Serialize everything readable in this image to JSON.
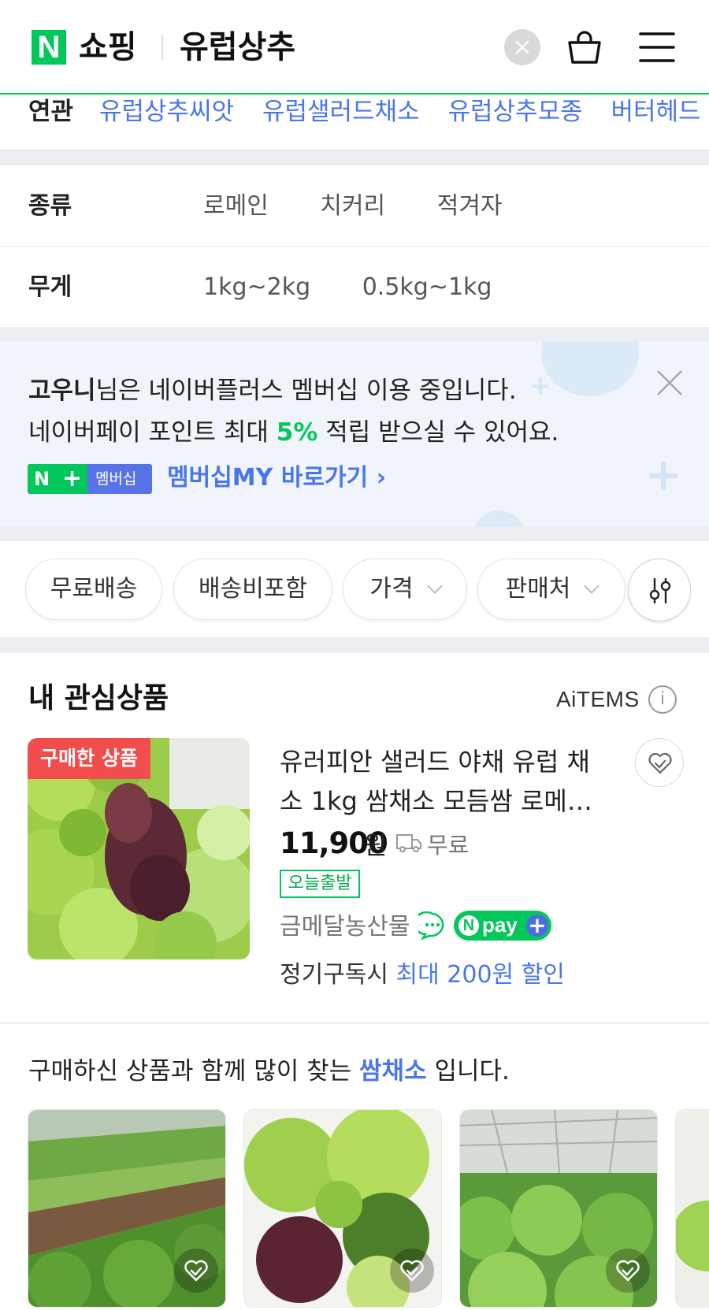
{
  "header": {
    "logo_letter": "N",
    "logo_text": "쇼핑",
    "query": "유럽상추"
  },
  "related": {
    "label": "연관",
    "items": [
      "유럽상추씨앗",
      "유럽샐러드채소",
      "유럽상추모종",
      "버터헤드"
    ]
  },
  "filters": [
    {
      "label": "종류",
      "options": [
        "로메인",
        "치커리",
        "적겨자"
      ]
    },
    {
      "label": "무게",
      "options": [
        "1kg~2kg",
        "0.5kg~1kg"
      ]
    }
  ],
  "banner": {
    "name": "고우니",
    "line1_rest": "님은 네이버플러스 멤버십 이용 중입니다.",
    "line2_pre": "네이버페이 포인트 최대 ",
    "line2_pct": "5%",
    "line2_post": " 적립 받으실 수 있어요.",
    "badge_n": "N",
    "badge_plus": "+",
    "badge_label": "멤버십",
    "link": "멤버십MY 바로가기"
  },
  "chips": [
    "무료배송",
    "배송비포함",
    "가격",
    "판매처"
  ],
  "interest": {
    "title": "내 관심상품",
    "brand": "AiTEMS",
    "info": "i"
  },
  "product": {
    "tag": "구매한 상품",
    "title": "유러피안 샐러드 야채 유럽 채소 1kg 쌈채소 모듬쌈 로메…",
    "price": "11,900",
    "won": "원",
    "shipping": "무료",
    "badge": "오늘출발",
    "seller": "금메달농산물",
    "npay_n": "N",
    "npay_text": "pay",
    "npay_plus": "+",
    "subscribe_pre": "정기구독시 ",
    "subscribe_disc": "최대 200원 할인"
  },
  "recommend": {
    "pre": "구매하신 상품과 함께 많이 찾는 ",
    "keyword": "쌈채소",
    "post": " 입니다."
  },
  "colors": {
    "brand_green": "#03c75a",
    "link_blue": "#4a76e8",
    "tag_red": "#f14d4d"
  }
}
